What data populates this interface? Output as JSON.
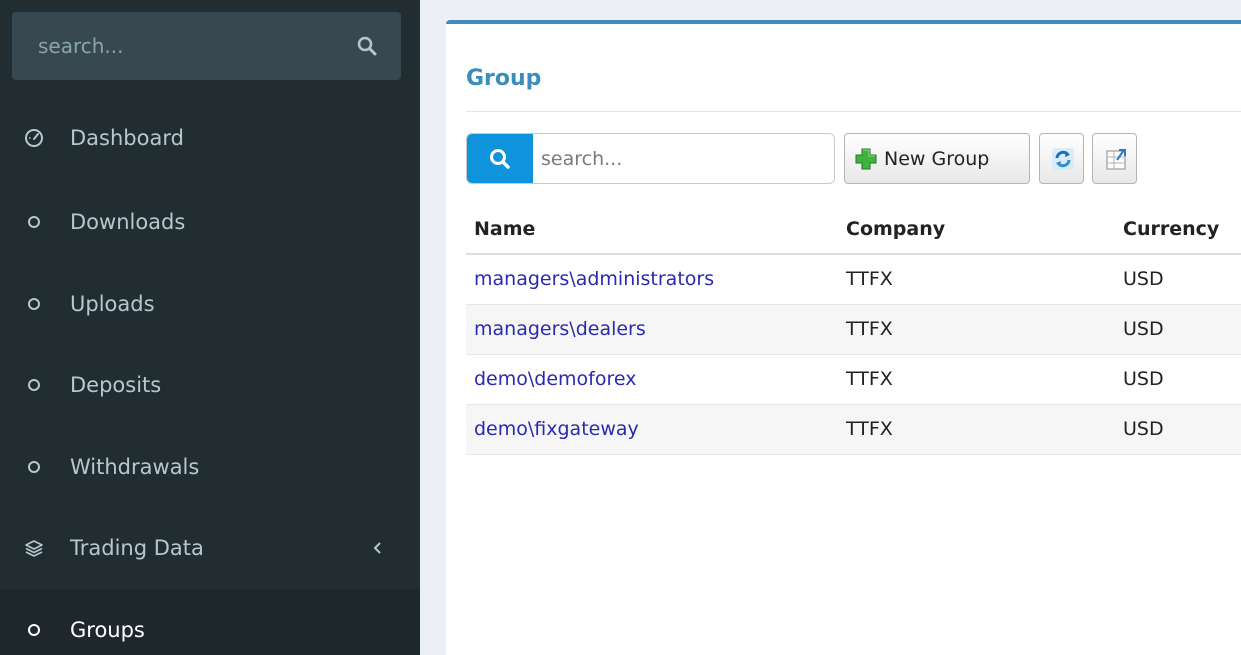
{
  "sidebar": {
    "search_placeholder": "search...",
    "items": [
      {
        "label": "Dashboard",
        "icon": "dashboard-icon"
      },
      {
        "label": "Downloads",
        "icon": "circle-icon"
      },
      {
        "label": "Uploads",
        "icon": "circle-icon"
      },
      {
        "label": "Deposits",
        "icon": "circle-icon"
      },
      {
        "label": "Withdrawals",
        "icon": "circle-icon"
      },
      {
        "label": "Trading Data",
        "icon": "layers-icon",
        "expandable": true
      },
      {
        "label": "Groups",
        "icon": "circle-icon",
        "active": true
      }
    ]
  },
  "main": {
    "title": "Group",
    "toolbar": {
      "search_placeholder": "search...",
      "new_label": "New Group",
      "refresh_icon": "refresh-icon",
      "export_icon": "export-icon"
    },
    "table": {
      "columns": [
        "Name",
        "Company",
        "Currency"
      ],
      "rows": [
        {
          "name": "managers\\administrators",
          "company": "TTFX",
          "currency": "USD"
        },
        {
          "name": "managers\\dealers",
          "company": "TTFX",
          "currency": "USD"
        },
        {
          "name": "demo\\demoforex",
          "company": "TTFX",
          "currency": "USD"
        },
        {
          "name": "demo\\fixgateway",
          "company": "TTFX",
          "currency": "USD"
        }
      ]
    }
  },
  "colors": {
    "sidebar_bg": "#222d32",
    "sidebar_text": "#b8c7ce",
    "accent": "#3c8dbc",
    "search_button": "#0f93dc",
    "link": "#2a2ab0"
  }
}
